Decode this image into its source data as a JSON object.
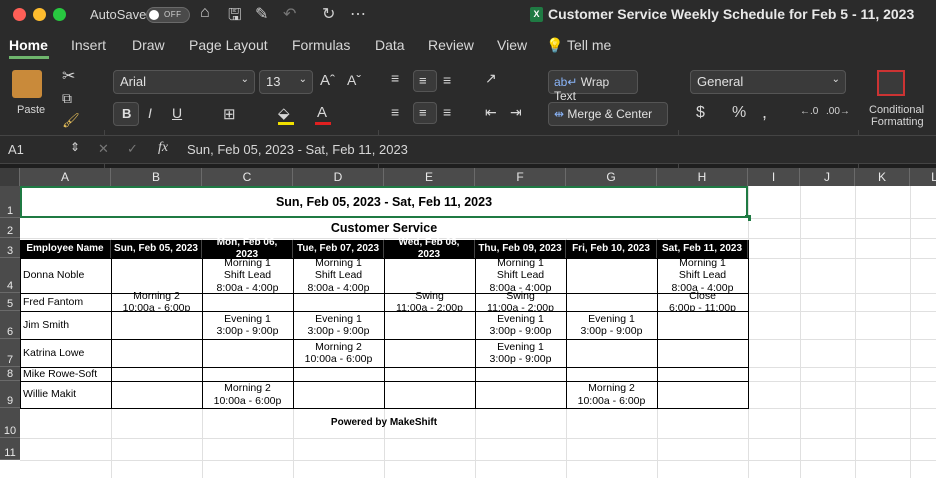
{
  "window": {
    "autosave_label": "AutoSave",
    "autosave_state": "OFF",
    "title": "Customer Service Weekly Schedule for Feb 5 - 11, 2023"
  },
  "tabs": [
    "Home",
    "Insert",
    "Draw",
    "Page Layout",
    "Formulas",
    "Data",
    "Review",
    "View",
    "Tell me"
  ],
  "ribbon": {
    "paste_label": "Paste",
    "font_name": "Arial",
    "font_size": "13",
    "wrap_text": "Wrap Text",
    "merge_center": "Merge & Center",
    "number_format": "General",
    "conditional_formatting_1": "Conditional",
    "conditional_formatting_2": "Formatting",
    "bold": "B",
    "italic": "I",
    "underline": "U"
  },
  "formula_bar": {
    "cell_ref": "A1",
    "fx": "fx",
    "value": "Sun, Feb 05, 2023 - Sat, Feb 11, 2023"
  },
  "columns": [
    "A",
    "B",
    "C",
    "D",
    "E",
    "F",
    "G",
    "H",
    "I",
    "J",
    "K",
    "L"
  ],
  "rows": [
    "1",
    "2",
    "3",
    "4",
    "5",
    "6",
    "7",
    "8",
    "9",
    "10",
    "11"
  ],
  "sheet": {
    "title": "Sun, Feb 05, 2023 - Sat, Feb 11, 2023",
    "subtitle": "Customer Service",
    "header": [
      "Employee Name",
      "Sun, Feb 05, 2023",
      "Mon, Feb 06, 2023",
      "Tue, Feb 07, 2023",
      "Wed, Feb 08, 2023",
      "Thu, Feb 09, 2023",
      "Fri, Feb 10, 2023",
      "Sat, Feb 11, 2023"
    ],
    "employees": [
      {
        "name": "Donna Noble",
        "shifts": [
          "",
          "Morning 1\nShift Lead\n8:00a - 4:00p",
          "Morning 1\nShift Lead\n8:00a - 4:00p",
          "",
          "Morning 1\nShift Lead\n8:00a - 4:00p",
          "",
          "Morning 1\nShift Lead\n8:00a - 4:00p"
        ]
      },
      {
        "name": "Fred Fantom",
        "shifts": [
          "Morning 2\n10:00a - 6:00p",
          "",
          "",
          "Swing\n11:00a - 2:00p",
          "Swing\n11:00a - 2:00p",
          "",
          "Close\n6:00p - 11:00p"
        ]
      },
      {
        "name": "Jim Smith",
        "shifts": [
          "",
          "Evening 1\n3:00p - 9:00p",
          "Evening 1\n3:00p - 9:00p",
          "",
          "Evening 1\n3:00p - 9:00p",
          "Evening 1\n3:00p - 9:00p",
          ""
        ]
      },
      {
        "name": "Katrina Lowe",
        "shifts": [
          "",
          "",
          "Morning 2\n10:00a - 6:00p",
          "",
          "Evening 1\n3:00p - 9:00p",
          "",
          ""
        ]
      },
      {
        "name": "Mike Rowe-Soft",
        "shifts": [
          "",
          "",
          "",
          "",
          "",
          "",
          ""
        ]
      },
      {
        "name": "Willie Makit",
        "shifts": [
          "",
          "Morning 2\n10:00a - 6:00p",
          "",
          "",
          "",
          "Morning 2\n10:00a - 6:00p",
          ""
        ]
      }
    ],
    "footer": "Powered by MakeShift"
  },
  "colors": {
    "accent": "#6fb66d",
    "header_bg": "#000000",
    "selection": "#1f7a43"
  }
}
